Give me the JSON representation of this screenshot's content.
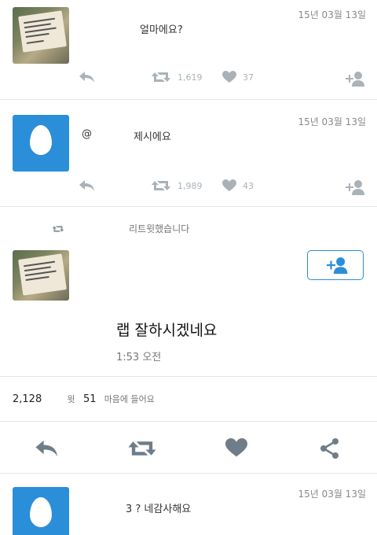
{
  "tweets": [
    {
      "timestamp": "15년 03월 13일",
      "text": "얼마에요?",
      "retweets": "1,619",
      "likes": "37"
    },
    {
      "timestamp": "15년 03월 13일",
      "mention": "@",
      "text": "제시에요",
      "retweets": "1,989",
      "likes": "43"
    }
  ],
  "retweet_notice": "리트윗했습니다",
  "focused": {
    "text": "랩 잘하시겠네요",
    "time": "1:53 오전",
    "retweet_count": "2,128",
    "retweet_label": "윗",
    "like_count": "51",
    "like_label": "마음에 들어요"
  },
  "reply": {
    "timestamp": "15년 03월 13일",
    "text": "3 ? 네감사해요"
  },
  "colors": {
    "accent": "#2b8ed8",
    "icon_gray": "#aab2b8",
    "icon_dark": "#6f7d89"
  }
}
